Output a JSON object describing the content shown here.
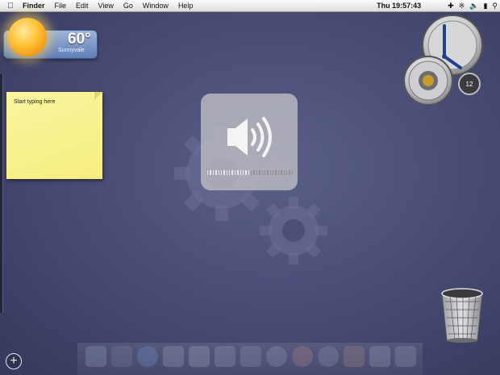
{
  "menubar": {
    "apple_icon": "apple-icon",
    "items": [
      "Finder",
      "File",
      "Edit",
      "View",
      "Go",
      "Window",
      "Help"
    ],
    "clock": "Thu 19:57:43",
    "status_icons": [
      "plus-icon",
      "bluetooth-icon",
      "volume-icon",
      "battery-icon",
      "spotlight-search-icon"
    ]
  },
  "weather": {
    "temperature": "60°",
    "city": "Sunnyvale",
    "icon": "sun-icon"
  },
  "sticky": {
    "text": "Start typing here"
  },
  "volume_hud": {
    "icon": "speaker-icon",
    "level_fraction": 0.5,
    "segments": 16
  },
  "clock_widget": {
    "dial_number": "12"
  },
  "desktop": {
    "trash_icon": "trash-icon",
    "add_widget_icon": "add-widget-icon"
  },
  "colors": {
    "background": "#4c5079",
    "sticky": "#f6ee7f",
    "weather": "#6f8cc0"
  }
}
